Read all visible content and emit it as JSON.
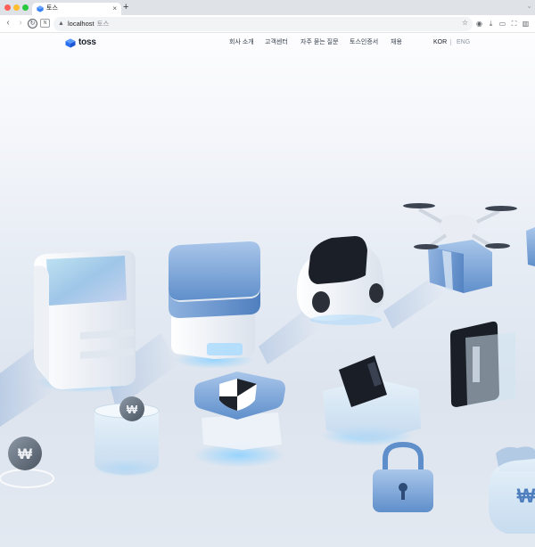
{
  "browser": {
    "tab_title": "토스",
    "tab_close": "×",
    "new_tab": "+",
    "url_host": "localhost",
    "url_title": "토스",
    "extension_badge": "N"
  },
  "site": {
    "logo_text": "toss",
    "nav": [
      "회사 소개",
      "고객센터",
      "자주 묻는 질문",
      "토스인증서",
      "채용"
    ],
    "lang_kor": "KOR",
    "lang_eng": "ENG"
  },
  "hero": {
    "currency_symbol": "₩"
  },
  "colors": {
    "brand_blue": "#3182f6",
    "object_blue": "#7fa7d6",
    "object_white": "#f4f6f9"
  }
}
